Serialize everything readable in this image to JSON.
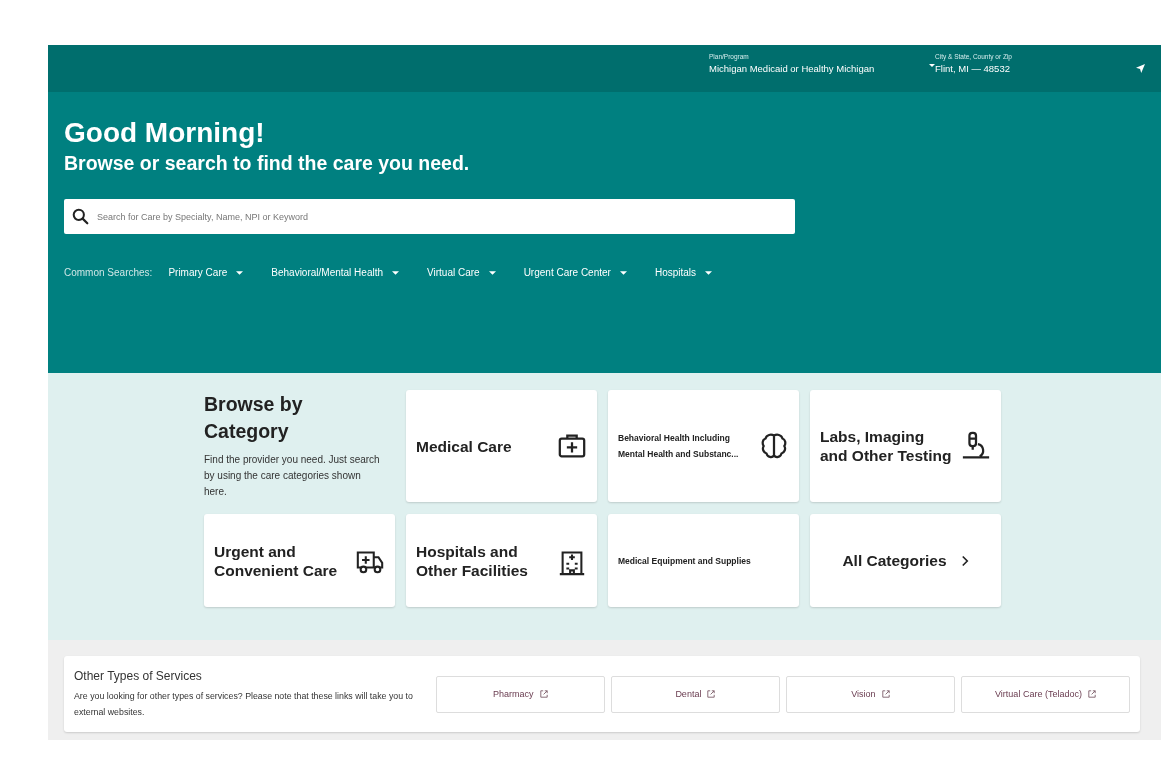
{
  "header": {
    "plan": {
      "label": "Plan/Program",
      "value": "Michigan Medicaid or Healthy Michigan"
    },
    "location": {
      "label": "City & State, County or Zip",
      "value": "Flint, MI — 48532"
    }
  },
  "hero": {
    "greeting": "Good Morning!",
    "subtitle": "Browse or search to find the care you need.",
    "search": {
      "placeholder": "Search for Care by Specialty, Name, NPI or Keyword"
    },
    "common_label": "Common Searches:",
    "common_searches": [
      "Primary Care",
      "Behavioral/Mental Health",
      "Virtual Care",
      "Urgent Care Center",
      "Hospitals"
    ]
  },
  "browse": {
    "title": "Browse by Category",
    "description": "Find the provider you need. Just search by using the care categories shown here.",
    "categories": [
      {
        "label": "Medical Care",
        "kind": "large"
      },
      {
        "label": "Behavioral Health Including Mental Health and Substanc...",
        "kind": "small"
      },
      {
        "label": "Labs, Imaging and Other Testing",
        "kind": "large"
      },
      {
        "label": "Urgent and Convenient Care",
        "kind": "large"
      },
      {
        "label": "Hospitals and Other Facilities",
        "kind": "large"
      },
      {
        "label": "Medical Equipment and Supplies",
        "kind": "small"
      },
      {
        "label": "All Categories",
        "kind": "link"
      }
    ]
  },
  "other_services": {
    "title": "Other Types of Services",
    "description": "Are you looking for other types of services? Please note that these links will take you to external websites.",
    "links": [
      "Pharmacy",
      "Dental",
      "Vision",
      "Virtual Care (Teladoc)"
    ]
  }
}
